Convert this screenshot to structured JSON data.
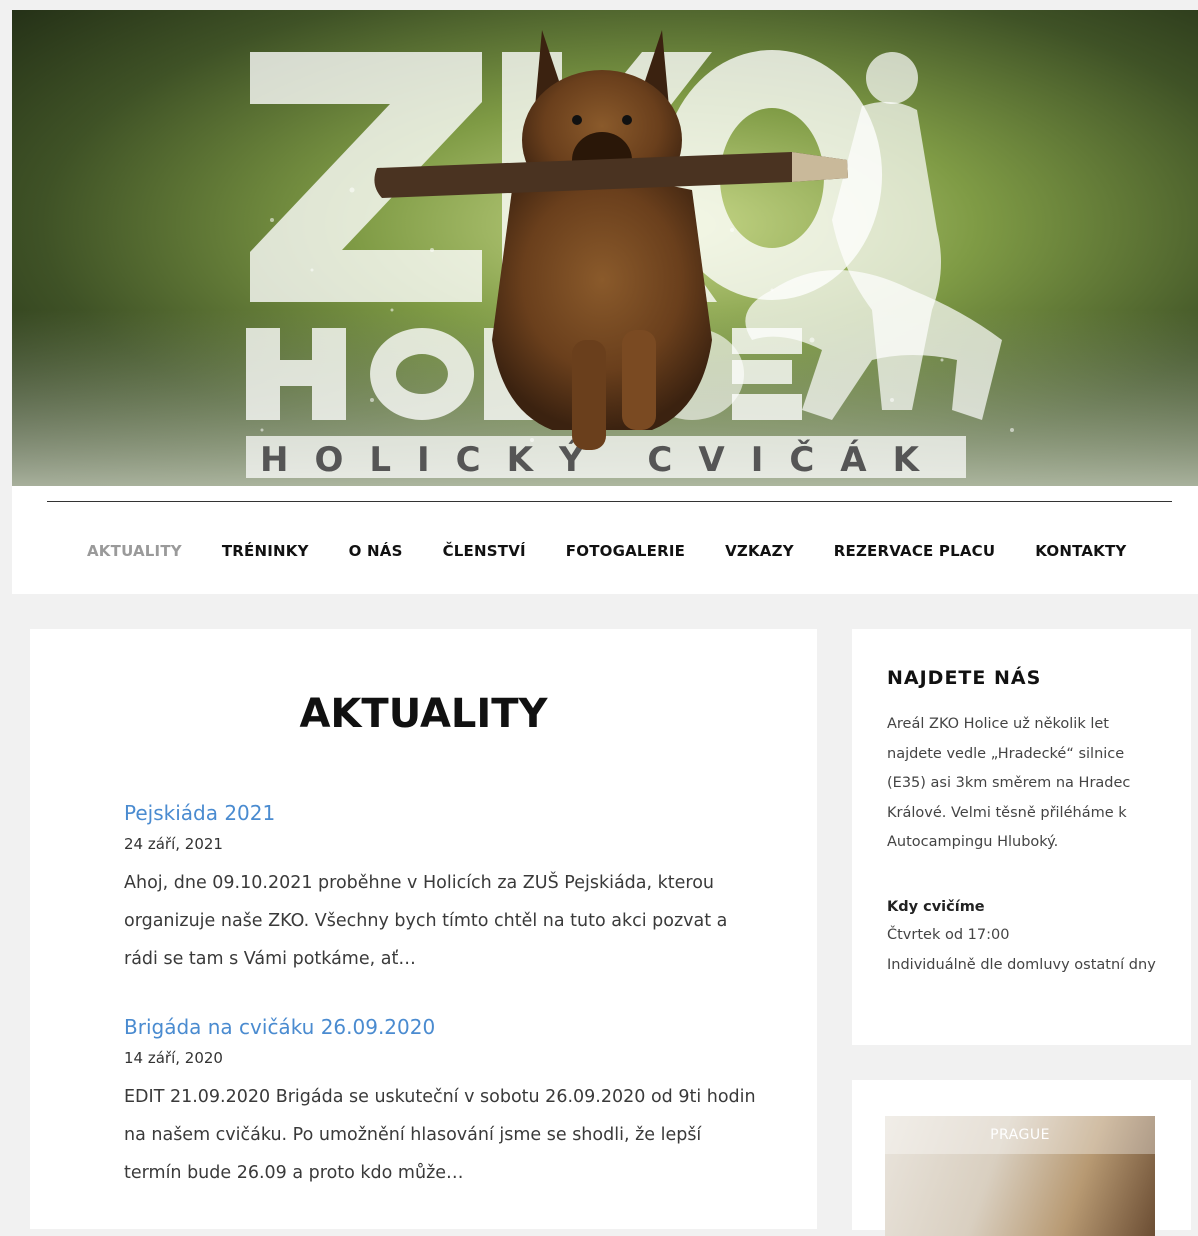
{
  "hero": {
    "logo_main": "ZKO",
    "logo_sub": "HOLICE",
    "logo_tagline": "HOLICKÝ CVIČÁK"
  },
  "nav": {
    "items": [
      {
        "label": "AKTUALITY",
        "active": true
      },
      {
        "label": "TRÉNINKY",
        "active": false
      },
      {
        "label": "O NÁS",
        "active": false
      },
      {
        "label": "ČLENSTVÍ",
        "active": false
      },
      {
        "label": "FOTOGALERIE",
        "active": false
      },
      {
        "label": "VZKAZY",
        "active": false
      },
      {
        "label": "REZERVACE PLACU",
        "active": false
      },
      {
        "label": "KONTAKTY",
        "active": false
      }
    ]
  },
  "main": {
    "title": "AKTUALITY",
    "posts": [
      {
        "title": "Pejskiáda 2021",
        "date": "24 září, 2021",
        "excerpt": "Ahoj, dne 09.10.2021 proběhne v Holicích za ZUŠ Pejskiáda, kterou organizuje naše ZKO. Všechny bych tímto chtěl na tuto akci pozvat a rádi se tam s Vámi potkáme, ať…"
      },
      {
        "title": "Brigáda na cvičáku 26.09.2020",
        "date": "14 září, 2020",
        "excerpt": "EDIT 21.09.2020 Brigáda se uskuteční v sobotu 26.09.2020 od 9ti hodin na našem cvičáku. Po umožnění hlasování jsme se shodli, že lepší termín bude 26.09 a proto kdo může…"
      }
    ]
  },
  "sidebar": {
    "find_us": {
      "title": "NAJDETE NÁS",
      "text": "Areál ZKO Holice už několik let najdete vedle „Hradecké“ silnice (E35) asi 3km směrem na Hradec Králové. Velmi těsně přiléháme k Autocampingu Hluboký.",
      "training_heading": "Kdy cvičíme",
      "training_line1": "Čtvrtek od 17:00",
      "training_line2": "Individuálně dle domluvy ostatní dny"
    },
    "gallery": {
      "label": "PRAGUE"
    }
  },
  "colors": {
    "accent_link": "#4a8bd0",
    "nav_active": "#9a9a9a",
    "page_bg": "#f1f1f1"
  }
}
